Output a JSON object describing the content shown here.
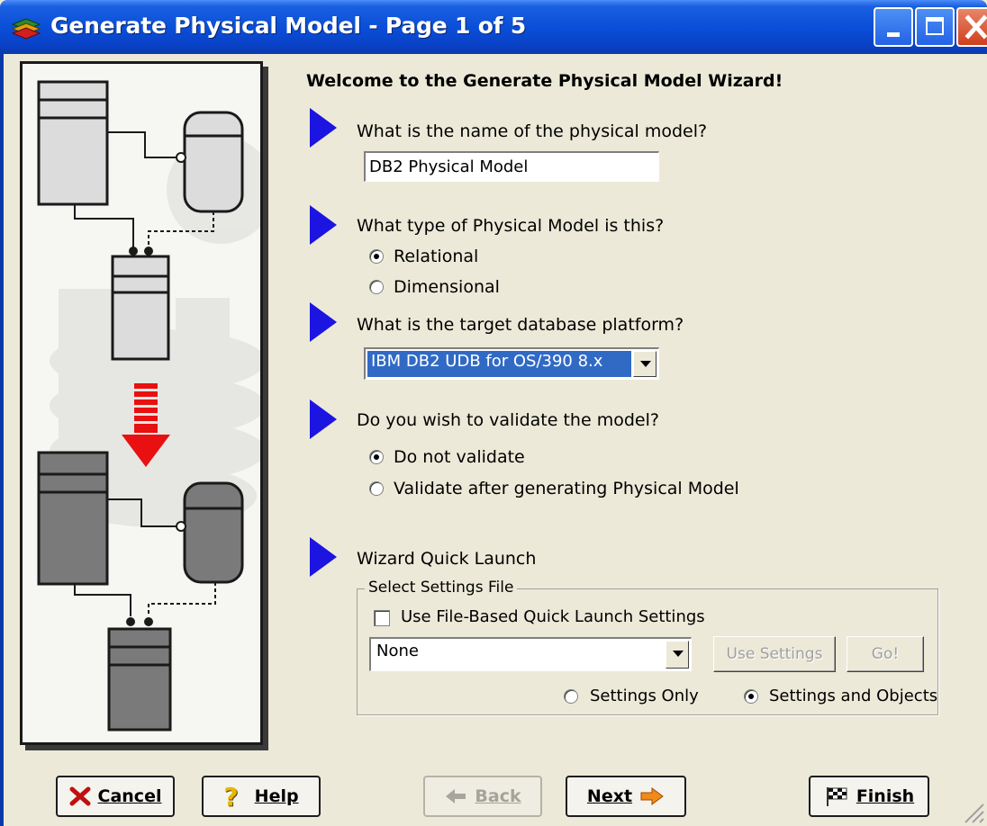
{
  "window": {
    "title": "Generate Physical Model - Page 1 of 5"
  },
  "welcome": "Welcome to the Generate Physical Model Wizard!",
  "questions": {
    "model_name": {
      "label": "What is the name of the physical model?",
      "value": "DB2 Physical Model"
    },
    "model_type": {
      "label": "What type of Physical Model is this?",
      "options": [
        "Relational",
        "Dimensional"
      ],
      "selected": "Relational"
    },
    "platform": {
      "label": "What is the target database platform?",
      "value": "IBM DB2 UDB for OS/390 8.x"
    },
    "validate": {
      "label": "Do you wish to validate the model?",
      "options": [
        "Do not validate",
        "Validate after generating Physical Model"
      ],
      "selected": "Do not validate"
    }
  },
  "quick_launch": {
    "label": "Wizard Quick Launch",
    "group_title": "Select Settings File",
    "checkbox_label": "Use File-Based Quick Launch Settings",
    "checkbox_checked": false,
    "settings_file": "None",
    "use_settings_label": "Use Settings",
    "go_label": "Go!",
    "scope_options": [
      "Settings Only",
      "Settings and Objects"
    ],
    "scope_selected": "Settings and Objects"
  },
  "buttons": {
    "cancel": "Cancel",
    "help": "Help",
    "back": "Back",
    "next": "Next",
    "finish": "Finish"
  },
  "colors": {
    "titlebar": "#0a4fd8",
    "dialog_bg": "#ece9d8",
    "arrow": "#1c14e0",
    "selection": "#316ac5",
    "red_arrow": "#e81010"
  }
}
